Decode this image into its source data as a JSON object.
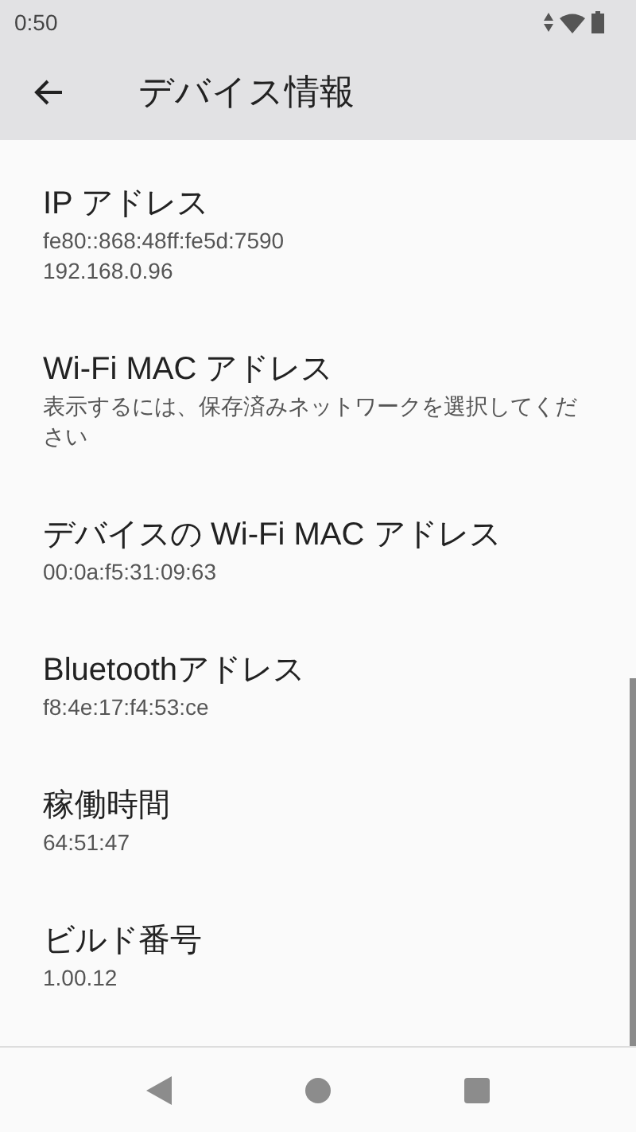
{
  "status_bar": {
    "time": "0:50"
  },
  "app_bar": {
    "title": "デバイス情報"
  },
  "items": [
    {
      "title": "IP アドレス",
      "lines": [
        "fe80::868:48ff:fe5d:7590",
        "192.168.0.96"
      ]
    },
    {
      "title": "Wi-Fi MAC アドレス",
      "lines": [
        "表示するには、保存済みネットワークを選択してください"
      ]
    },
    {
      "title": "デバイスの Wi-Fi MAC アドレス",
      "lines": [
        "00:0a:f5:31:09:63"
      ]
    },
    {
      "title": "Bluetoothアドレス",
      "lines": [
        "f8:4e:17:f4:53:ce"
      ]
    },
    {
      "title": "稼働時間",
      "lines": [
        "64:51:47"
      ]
    },
    {
      "title": "ビルド番号",
      "lines": [
        "1.00.12"
      ]
    }
  ]
}
